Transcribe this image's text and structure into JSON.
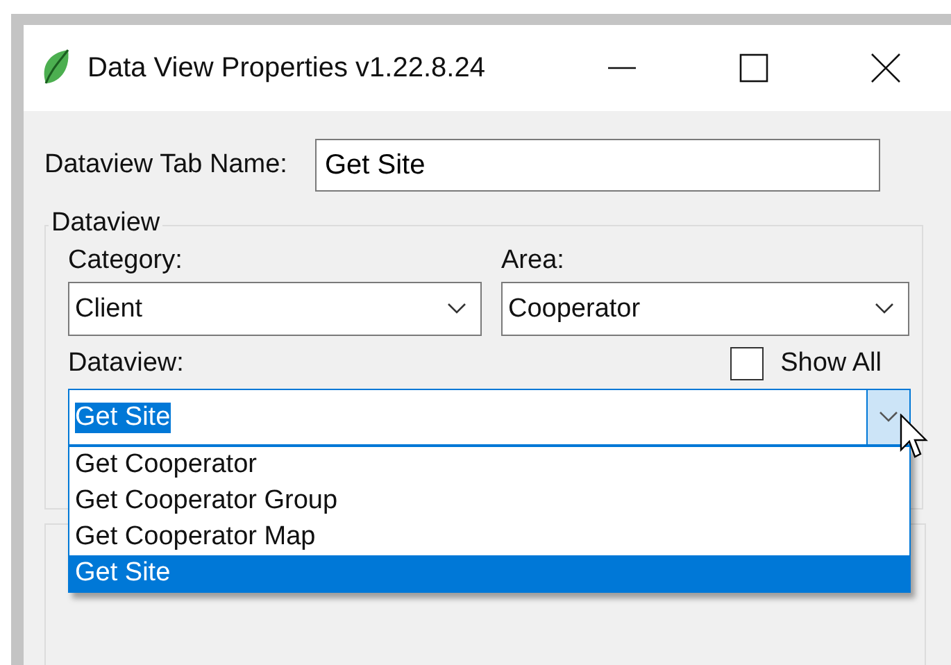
{
  "window": {
    "title": "Data View Properties v1.22.8.24"
  },
  "tab_name": {
    "label": "Dataview Tab Name:",
    "value": "Get Site"
  },
  "dataview_group": {
    "legend": "Dataview",
    "category": {
      "label": "Category:",
      "value": "Client"
    },
    "area": {
      "label": "Area:",
      "value": "Cooperator"
    },
    "dataview": {
      "label": "Dataview:",
      "value": "Get Site",
      "expanded": true,
      "options": [
        {
          "label": "Get Cooperator",
          "selected": false
        },
        {
          "label": "Get Cooperator Group",
          "selected": false
        },
        {
          "label": "Get Cooperator Map",
          "selected": false
        },
        {
          "label": "Get Site",
          "selected": true
        }
      ]
    },
    "show_all": {
      "label": "Show All",
      "checked": false
    }
  }
}
